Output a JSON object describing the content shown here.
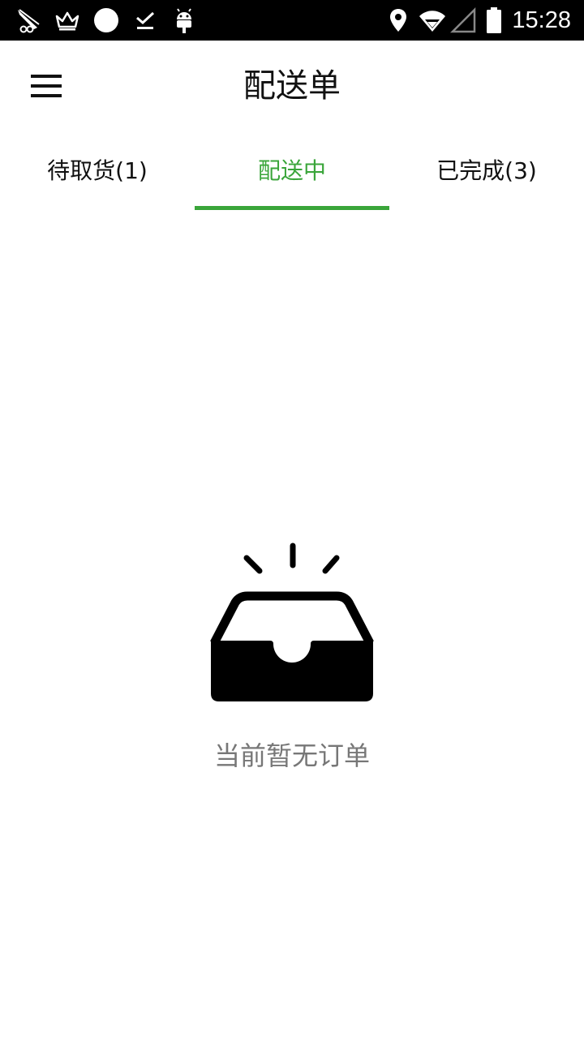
{
  "status_bar": {
    "time": "15:28",
    "left_icons": [
      "feather-icon",
      "crown-icon",
      "circle-icon",
      "download-done-icon",
      "android-icon"
    ],
    "right_icons": [
      "location-icon",
      "wifi-icon",
      "signal-icon",
      "battery-icon"
    ]
  },
  "toolbar": {
    "title": "配送单",
    "menu_icon": "hamburger-menu-icon"
  },
  "tabs": [
    {
      "label": "待取货(1)",
      "active": false
    },
    {
      "label": "配送中",
      "active": true
    },
    {
      "label": "已完成(3)",
      "active": false
    }
  ],
  "empty_state": {
    "icon": "empty-inbox-icon",
    "message": "当前暂无订单"
  },
  "colors": {
    "accent": "#3aa53a",
    "status_bar": "#000000",
    "text": "#111111",
    "muted_text": "#777777"
  }
}
